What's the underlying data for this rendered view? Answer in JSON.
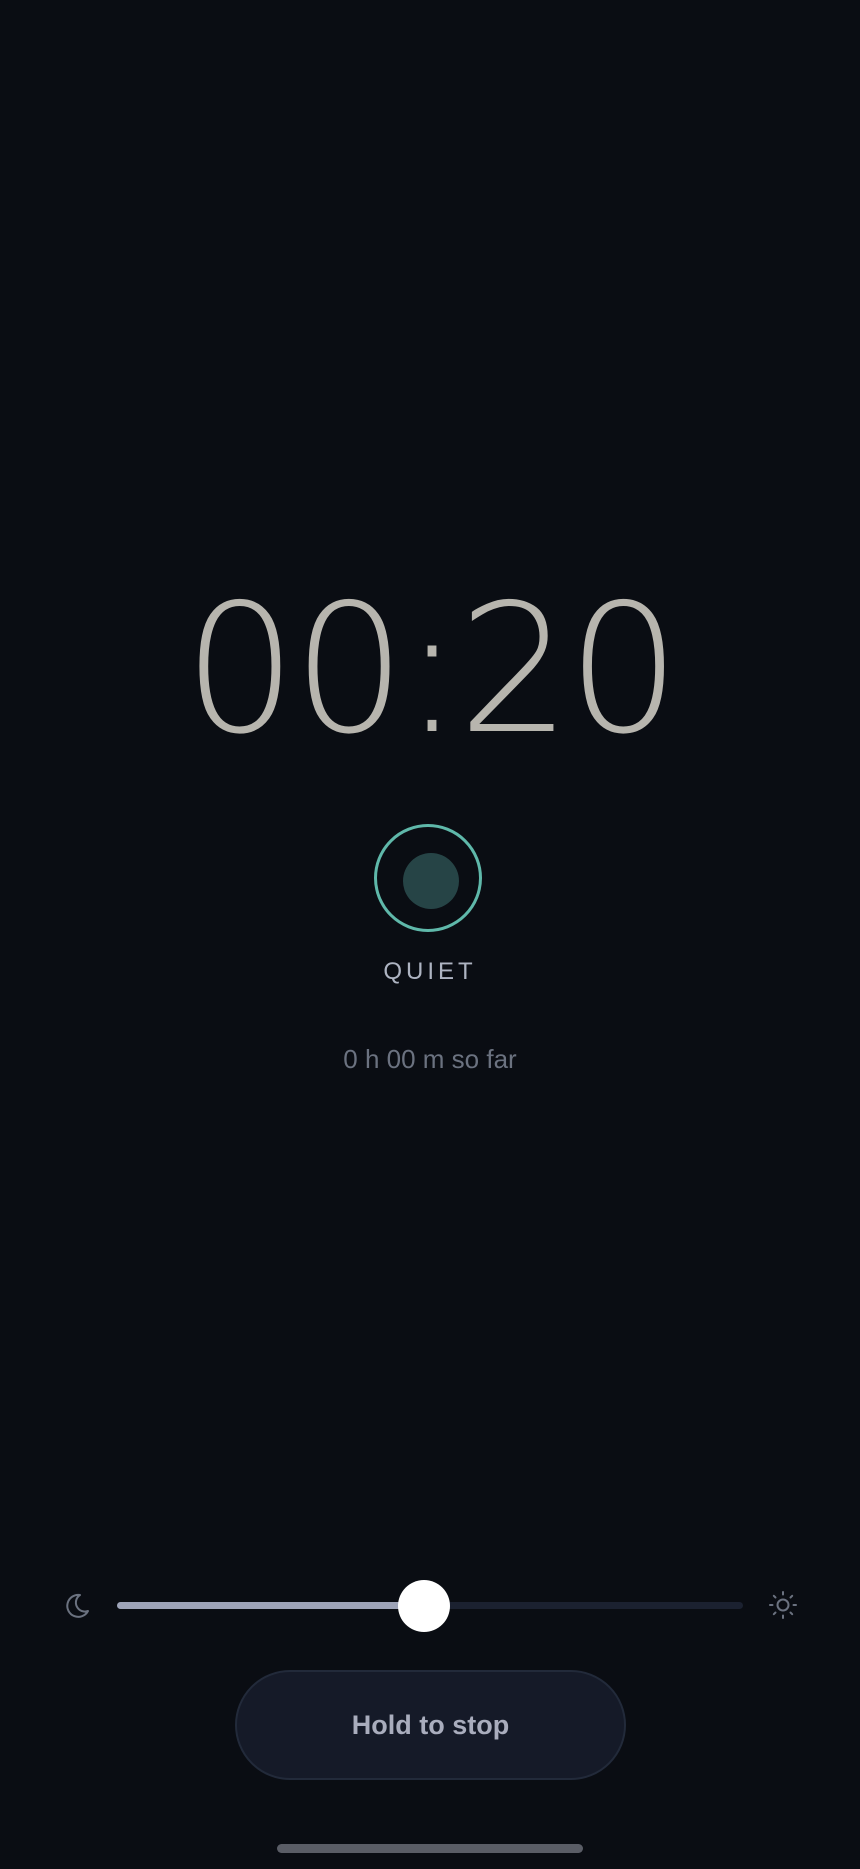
{
  "timer": {
    "display": "00:20"
  },
  "status": {
    "label": "QUIET",
    "ring_color": "#5fb8aa",
    "dot_color": "#264446"
  },
  "elapsed": {
    "text": "0 h 00 m so far"
  },
  "brightness": {
    "min_icon": "moon-icon",
    "max_icon": "sun-icon",
    "level_percent": 49
  },
  "stop_button": {
    "label": "Hold to stop"
  },
  "theme": {
    "background": "#0a0d13",
    "text_primary": "#b7b5ae",
    "text_muted": "#6b7280"
  }
}
